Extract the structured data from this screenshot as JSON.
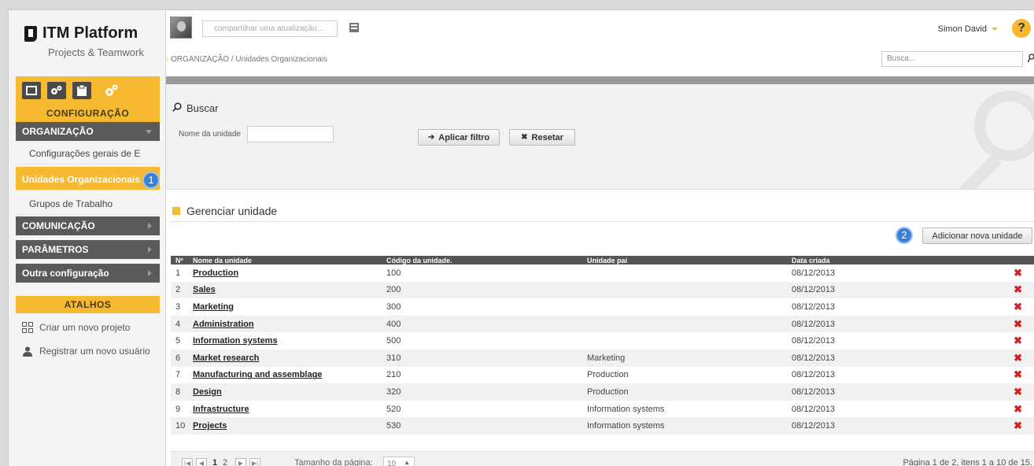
{
  "app": {
    "title": "ITM Platform",
    "subtitle": "Projects & Teamwork"
  },
  "colors": {
    "accent": "#f7b832",
    "section": "#5a5a5a",
    "badge": "#3b7fd6",
    "delete": "#d42020"
  },
  "module": {
    "label": "CONFIGURAÇÃO",
    "icons": [
      "square-icon",
      "gears-icon",
      "clipboard-icon",
      "settings-icon"
    ]
  },
  "sidebar": {
    "sections": [
      {
        "label": "ORGANIZAÇÃO",
        "expanded": true
      },
      {
        "label": "COMUNICAÇÃO",
        "expanded": false
      },
      {
        "label": "PARÂMETROS",
        "expanded": false
      },
      {
        "label": "Outra configuração",
        "expanded": false
      }
    ],
    "items": [
      {
        "label": "Configurações gerais de E",
        "active": false
      },
      {
        "label": "Unidades Organizacionais",
        "active": true
      },
      {
        "label": "Grupos de Trabalho",
        "active": false
      }
    ],
    "shortcuts_title": "ATALHOS",
    "shortcuts": [
      {
        "label": "Criar um novo projeto",
        "icon": "project-icon"
      },
      {
        "label": "Registrar um novo usuário",
        "icon": "user-icon"
      }
    ]
  },
  "callouts": {
    "one": "1",
    "two": "2"
  },
  "topbar": {
    "status_placeholder": "compartilhar uma atualização...",
    "user": "Simon David",
    "help": "?",
    "breadcrumb": "ORGANIZAÇÃO / Unidades Organizacionais",
    "search_placeholder": "Busca..."
  },
  "filter": {
    "title": "Buscar",
    "field_label": "Nome da unidade",
    "apply_label": "Aplicar filtro",
    "reset_label": "Resetar"
  },
  "manage": {
    "title": "Gerenciar unidade",
    "add_label": "Adicionar nova unidade"
  },
  "table": {
    "headers": [
      "Nº",
      "Nome da unidade",
      "Código da unidade.",
      "Unidade pai",
      "Data criada"
    ],
    "rows": [
      {
        "n": "1",
        "name": "Production",
        "code": "100",
        "parent": "",
        "date": "08/12/2013"
      },
      {
        "n": "2",
        "name": "Sales",
        "code": "200",
        "parent": "",
        "date": "08/12/2013"
      },
      {
        "n": "3",
        "name": "Marketing",
        "code": "300",
        "parent": "",
        "date": "08/12/2013"
      },
      {
        "n": "4",
        "name": "Administration",
        "code": "400",
        "parent": "",
        "date": "08/12/2013"
      },
      {
        "n": "5",
        "name": "Information systems",
        "code": "500",
        "parent": "",
        "date": "08/12/2013"
      },
      {
        "n": "6",
        "name": "Market research",
        "code": "310",
        "parent": "Marketing",
        "date": "08/12/2013"
      },
      {
        "n": "7",
        "name": "Manufacturing and assemblage",
        "code": "210",
        "parent": "Production",
        "date": "08/12/2013"
      },
      {
        "n": "8",
        "name": "Design",
        "code": "320",
        "parent": "Production",
        "date": "08/12/2013"
      },
      {
        "n": "9",
        "name": "Infrastructure",
        "code": "520",
        "parent": "Information systems",
        "date": "08/12/2013"
      },
      {
        "n": "10",
        "name": "Projects",
        "code": "530",
        "parent": "Information systems",
        "date": "08/12/2013"
      }
    ]
  },
  "pager": {
    "pages": [
      "1",
      "2"
    ],
    "current_page": "1",
    "size_label": "Tamanho da página:",
    "size_value": "10",
    "info": "Página 1 de 2, itens 1 a 10 de 15."
  }
}
